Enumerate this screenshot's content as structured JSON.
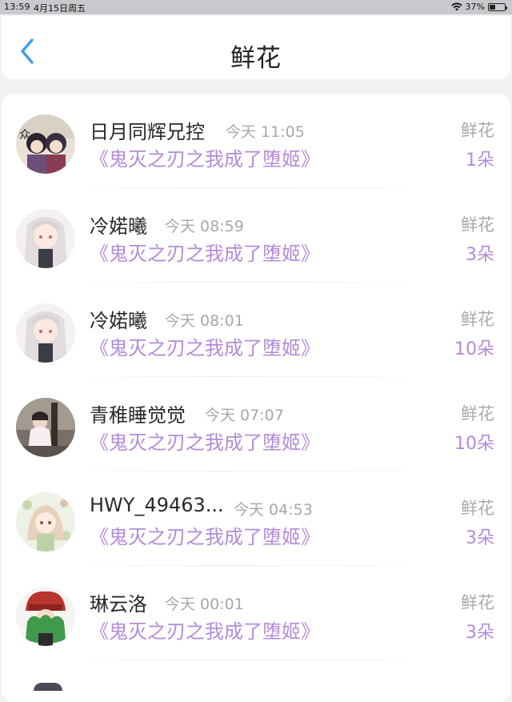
{
  "status_bar": {
    "time": "13:59",
    "date": "4月15日周五",
    "battery": "37%",
    "battery_level": 0.37
  },
  "nav": {
    "title": "鲜花",
    "back_icon": "chevron-left-icon",
    "accent": "#3d9fe8"
  },
  "colors": {
    "purple": "#b48ad8",
    "gray_text": "#a8a8a8"
  },
  "items": [
    {
      "username": "日月同辉兄控",
      "time": "今天 11:05",
      "book": "《鬼灭之刃之我成了堕姬》",
      "gift": "鲜花",
      "count": "1朵"
    },
    {
      "username": "冷婼曦",
      "time": "今天 08:59",
      "book": "《鬼灭之刃之我成了堕姬》",
      "gift": "鲜花",
      "count": "3朵"
    },
    {
      "username": "冷婼曦",
      "time": "今天 08:01",
      "book": "《鬼灭之刃之我成了堕姬》",
      "gift": "鲜花",
      "count": "10朵"
    },
    {
      "username": "青稚睡觉觉",
      "time": "今天 07:07",
      "book": "《鬼灭之刃之我成了堕姬》",
      "gift": "鲜花",
      "count": "10朵"
    },
    {
      "username": "HWY_49463...",
      "time": "今天 04:53",
      "book": "《鬼灭之刃之我成了堕姬》",
      "gift": "鲜花",
      "count": "3朵"
    },
    {
      "username": "琳云洛",
      "time": "今天 00:01",
      "book": "《鬼灭之刃之我成了堕姬》",
      "gift": "鲜花",
      "count": "3朵"
    }
  ]
}
